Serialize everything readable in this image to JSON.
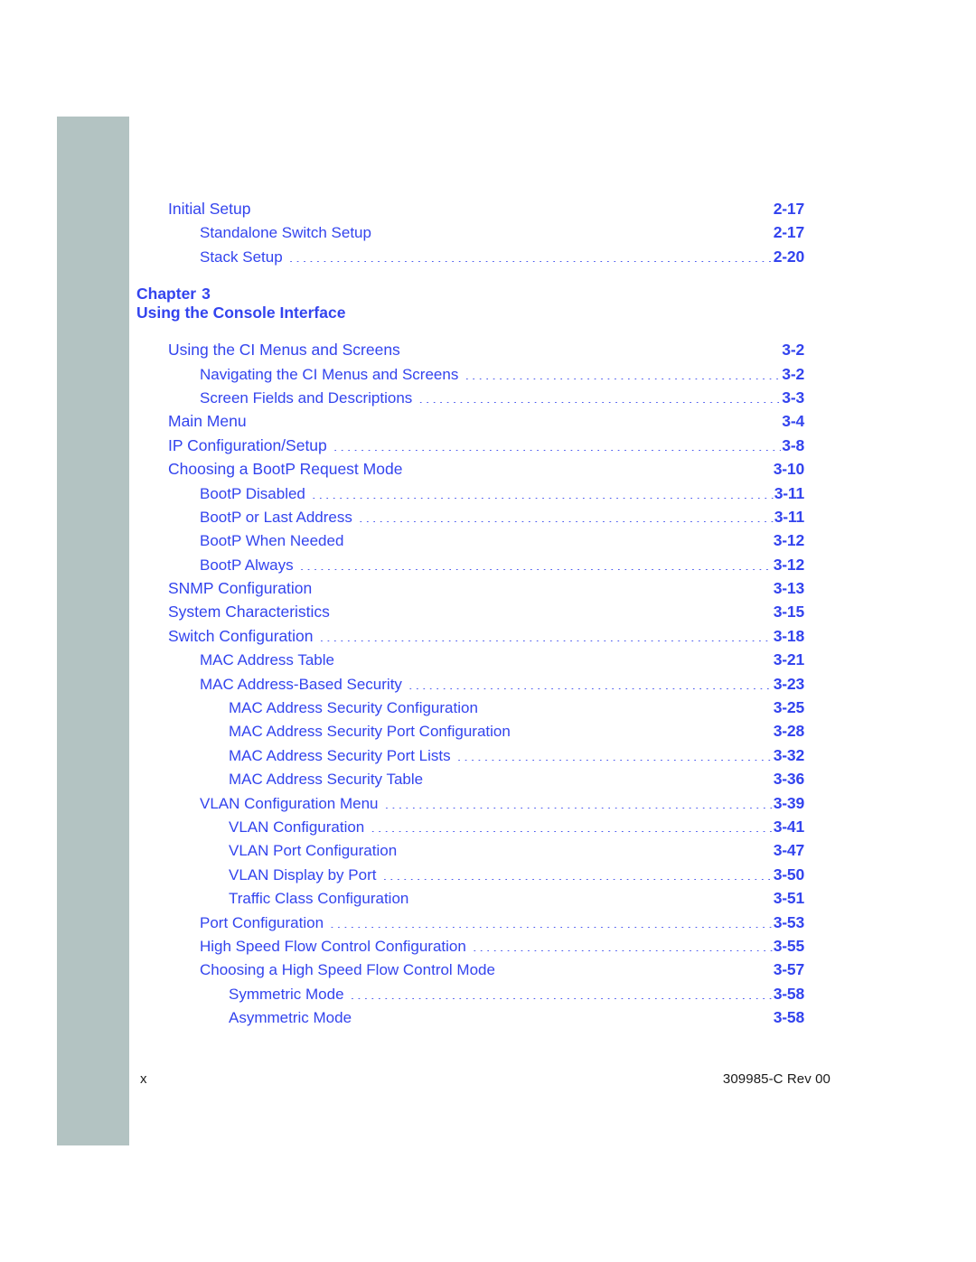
{
  "document": {
    "type": "table-of-contents",
    "colors": {
      "link_blue": "#3344ee",
      "side_bar": "#b3c3c2",
      "footer_text": "#1a1a1a"
    }
  },
  "toc": {
    "entries": [
      {
        "title": "Initial Setup",
        "page": "2-17",
        "level": 1
      },
      {
        "title": "Standalone Switch Setup",
        "page": "2-17",
        "level": 2
      },
      {
        "title": "Stack Setup",
        "page": "2-20",
        "level": 2
      }
    ]
  },
  "chapter": {
    "label": "Chapter",
    "number": "3",
    "title": "Using the Console Interface"
  },
  "toc2": {
    "entries": [
      {
        "title": "Using the CI Menus and Screens",
        "page": "3-2",
        "level": 1
      },
      {
        "title": "Navigating the CI Menus and Screens",
        "page": "3-2",
        "level": 2
      },
      {
        "title": "Screen Fields and Descriptions",
        "page": "3-3",
        "level": 2
      },
      {
        "title": "Main Menu",
        "page": "3-4",
        "level": 1
      },
      {
        "title": "IP Configuration/Setup",
        "page": "3-8",
        "level": 1
      },
      {
        "title": "Choosing a BootP Request Mode",
        "page": "3-10",
        "level": 1
      },
      {
        "title": "BootP Disabled",
        "page": "3-11",
        "level": 2
      },
      {
        "title": "BootP or Last Address",
        "page": "3-11",
        "level": 2
      },
      {
        "title": "BootP When Needed",
        "page": "3-12",
        "level": 2
      },
      {
        "title": "BootP Always",
        "page": "3-12",
        "level": 2
      },
      {
        "title": "SNMP Configuration",
        "page": "3-13",
        "level": 1
      },
      {
        "title": "System Characteristics",
        "page": "3-15",
        "level": 1
      },
      {
        "title": "Switch Configuration",
        "page": "3-18",
        "level": 1
      },
      {
        "title": "MAC Address Table",
        "page": "3-21",
        "level": 2
      },
      {
        "title": "MAC Address-Based Security",
        "page": "3-23",
        "level": 2
      },
      {
        "title": "MAC Address Security Configuration",
        "page": "3-25",
        "level": 3
      },
      {
        "title": "MAC Address Security Port Configuration",
        "page": "3-28",
        "level": 3
      },
      {
        "title": "MAC Address Security Port Lists",
        "page": "3-32",
        "level": 3
      },
      {
        "title": "MAC Address Security Table",
        "page": "3-36",
        "level": 3
      },
      {
        "title": "VLAN Configuration Menu",
        "page": "3-39",
        "level": 2
      },
      {
        "title": "VLAN Configuration",
        "page": "3-41",
        "level": 3
      },
      {
        "title": "VLAN Port Configuration",
        "page": "3-47",
        "level": 3
      },
      {
        "title": "VLAN Display by Port",
        "page": "3-50",
        "level": 3
      },
      {
        "title": "Traffic Class Configuration",
        "page": "3-51",
        "level": 3
      },
      {
        "title": "Port Configuration",
        "page": "3-53",
        "level": 2
      },
      {
        "title": "High Speed Flow Control Configuration",
        "page": "3-55",
        "level": 2
      },
      {
        "title": "Choosing a High Speed Flow Control Mode",
        "page": "3-57",
        "level": 2
      },
      {
        "title": "Symmetric Mode",
        "page": "3-58",
        "level": 3
      },
      {
        "title": "Asymmetric Mode",
        "page": "3-58",
        "level": 3
      }
    ]
  },
  "footer": {
    "folio": "x",
    "document_id": "309985-C Rev 00"
  }
}
